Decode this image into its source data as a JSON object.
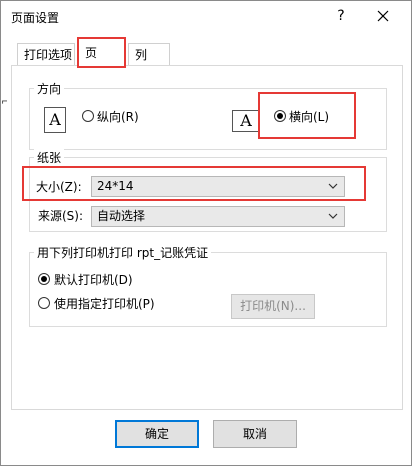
{
  "window": {
    "title": "页面设置",
    "help": "?"
  },
  "tabs": [
    {
      "label": "打印选项"
    },
    {
      "label": "页"
    },
    {
      "label": "列"
    }
  ],
  "orientation": {
    "group_label": "方向",
    "portrait_glyph": "A",
    "portrait_label": "纵向(R)",
    "landscape_glyph": "A",
    "landscape_label": "横向(L)",
    "selected": "landscape"
  },
  "paper": {
    "group_label": "纸张",
    "size_label": "大小(Z):",
    "size_value": "24*14",
    "source_label": "来源(S):",
    "source_value": "自动选择"
  },
  "printer": {
    "group_label": "用下列打印机打印 rpt_记账凭证",
    "default_label": "默认打印机(D)",
    "specific_label": "使用指定打印机(P)",
    "printer_button": "打印机(N)...",
    "selected": "default"
  },
  "footer": {
    "ok": "确定",
    "cancel": "取消"
  },
  "colors": {
    "highlight": "#e53935",
    "focus_border": "#0078d7"
  }
}
